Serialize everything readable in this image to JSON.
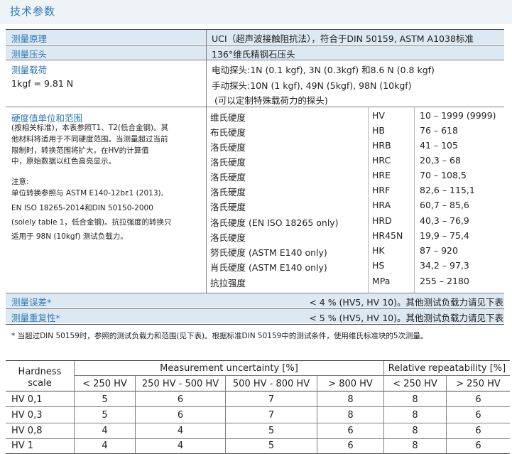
{
  "title": "技术参数",
  "rows": {
    "principle": {
      "label": "测量原理",
      "value": "UCI（超声波接触阻抗法），符合于DIN 50159, ASTM A1038标准"
    },
    "probe": {
      "label": "测量压头",
      "value": "136°维氏精钢石压头"
    },
    "load": {
      "label": "测量载荷",
      "sublabel": "1kgf = 9.81 N",
      "lines": [
        "电动探头:1N (0.1 kgf), 3N (0.3kgf) 和8.6 N (0.8 kgf)",
        "手动探头:10N (1 kgf), 49N (5kgf), 98N (10kgf)",
        "(可以定制特殊载荷力的探头)"
      ]
    },
    "scales": {
      "label": "硬度值单位和范围",
      "desc": [
        "(按相关标准)，本表参照T1、T2(低合金钢)。其",
        "他材料将适用于不同硬度范围。当测量超过当前",
        "限制时，转换范围将扩大。在HV的计算值",
        "中，原始数据以红色高亮显示。"
      ],
      "note": [
        "注意:",
        "单位转换参照与 ASTM E140-12bɛ1 (2013),",
        "EN ISO 18265-2014和DIN 50150-2000",
        "(solely table 1，低合金钢)。抗拉强度的转换只",
        "适用于 98N (10kgf) 测试负载力。"
      ],
      "items": [
        {
          "name": "维氏硬度",
          "unit": "HV",
          "range": "10 – 1999 (9999)"
        },
        {
          "name": "布氏硬度",
          "unit": "HB",
          "range": "76 – 618"
        },
        {
          "name": "洛氏硬度",
          "unit": "HRB",
          "range": "41 – 105"
        },
        {
          "name": "洛氏硬度",
          "unit": "HRC",
          "range": "20,3 – 68"
        },
        {
          "name": "洛氏硬度",
          "unit": "HRE",
          "range": "70 – 108,5"
        },
        {
          "name": "洛氏硬度",
          "unit": "HRF",
          "range": "82,6 – 115,1"
        },
        {
          "name": "洛氏硬度",
          "unit": "HRA",
          "range": "60,7 – 85,6"
        },
        {
          "name": "洛氏硬度 (EN ISO 18265 only)",
          "unit": "HRD",
          "range": "40,3 – 76,9"
        },
        {
          "name": "洛氏硬度",
          "unit": "HR45N",
          "range": "19,9 – 75,4"
        },
        {
          "name": "努氏硬度 (ASTM E140 only)",
          "unit": "HK",
          "range": "87 – 920"
        },
        {
          "name": "肖氏硬度 (ASTM E140 only)",
          "unit": "HS",
          "range": "34,2 – 97,3"
        },
        {
          "name": "抗拉强度",
          "unit": "MPa",
          "range": "255 – 2180"
        }
      ]
    },
    "error": {
      "label": "测量误差*",
      "value": "< 4 % (HV5, HV 10)。其他测试负载力请见下表"
    },
    "repeat": {
      "label": "测量重复性*",
      "value": "< 5 % (HV5, HV 10)。其他测试负载力请见下表"
    }
  },
  "footnote": "* 当超过DIN 50159时，参照的测试负载力和范围(见下表)。根据标准DIN 50159中的测试条件，使用维氏标准块的5次测量。",
  "table2": {
    "col0": [
      "Hardness",
      "scale"
    ],
    "group1": "Measurement uncertainty [%]",
    "group2": "Relative repeatability [%]",
    "subheaders": [
      "< 250 HV",
      "250 HV - 500 HV",
      "500 HV - 800 HV",
      "> 800 HV",
      "< 250 HV",
      "> 250 HV"
    ],
    "rows": [
      {
        "scale": "HV 0,1",
        "values": [
          "5",
          "6",
          "7",
          "8",
          "8",
          "6"
        ]
      },
      {
        "scale": "HV 0,3",
        "values": [
          "5",
          "6",
          "7",
          "8",
          "8",
          "6"
        ]
      },
      {
        "scale": "HV 0,8",
        "values": [
          "4",
          "4",
          "5",
          "6",
          "8",
          "6"
        ]
      },
      {
        "scale": "HV 1",
        "values": [
          "4",
          "4",
          "5",
          "6",
          "8",
          "6"
        ]
      }
    ]
  }
}
